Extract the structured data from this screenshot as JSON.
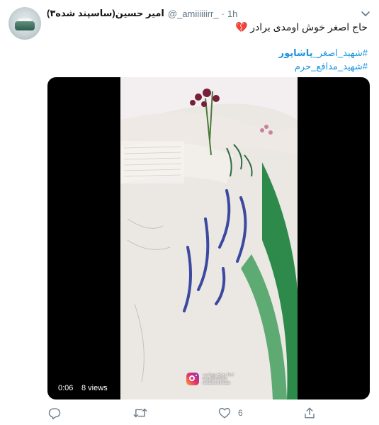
{
  "tweet": {
    "display_name": "امیر حسین(ساسپند شده۳)",
    "handle": "@_amiiiiiirr_",
    "time": "1h",
    "text": "حاج اصغر خوش اومدی برادر",
    "heart_emoji": "💔",
    "hashtags": [
      {
        "hash": "#",
        "plain": "شهید_اصغر_",
        "bold": "پاشاپور"
      },
      {
        "hash": "#",
        "plain": "شهید_مدافع_حرم",
        "bold": ""
      }
    ],
    "icons": {
      "avatar": "avatar",
      "caret": "chevron-down-icon",
      "reply": "reply-icon",
      "retweet": "retweet-icon",
      "like": "heart-icon",
      "share": "share-icon",
      "watermark": "instagram-icon"
    }
  },
  "media": {
    "duration": "0:06",
    "views": "8 views",
    "watermark_line1": "اینجا معراج شهداست",
    "watermark_line2": "merajoshohada",
    "watermark_line3": "rafabososhohada"
  },
  "actions": {
    "reply_count": "",
    "retweet_count": "",
    "like_count": "6",
    "share_count": ""
  },
  "colors": {
    "link": "#1b95e0",
    "secondary": "#657786",
    "heart_emoji": "#e0245e"
  }
}
